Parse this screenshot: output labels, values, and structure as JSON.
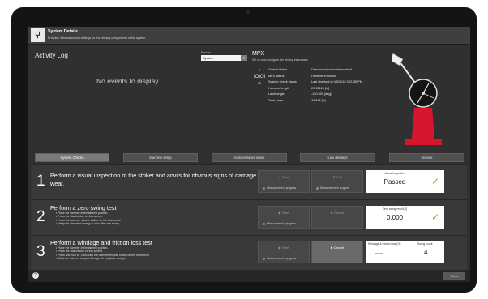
{
  "window": {
    "title": "System Details",
    "subtitle": "Provides information and settings for the primary components of the system.",
    "icon": "fork-knife-icon"
  },
  "activity_log": {
    "title": "Activity Log",
    "empty_text": "No events to display.",
    "device_label": "Source",
    "device_value": "System"
  },
  "mpx": {
    "title": "MPX",
    "subtitle": "Set up and configure the testing instrument.",
    "status_rows": [
      {
        "key": "Overall status",
        "value": "Demonstration mode enabled"
      },
      {
        "key": "MPX status",
        "value": "Hammer in motion"
      },
      {
        "key": "System check status",
        "value": "Last checked at 4/5/2016 3:21:35 PM"
      },
      {
        "key": "Hammer length",
        "value": "29.92126 [in]"
      },
      {
        "key": "Latch angle",
        "value": "-120.000 [deg]"
      },
      {
        "key": "Total mass",
        "value": "44.092 [lb]"
      }
    ],
    "colors": {
      "base": "#d6162e",
      "pendulum": "#111111"
    }
  },
  "tabs": [
    {
      "label": "System Checks",
      "active": true
    },
    {
      "label": "Machine setup",
      "active": false
    },
    {
      "label": "Administrative setup",
      "active": false
    },
    {
      "label": "Live displays",
      "active": false
    },
    {
      "label": "Service",
      "active": false
    }
  ],
  "steps": [
    {
      "number": "1",
      "title": "Perform a visual inspection of the striker and anvils for obvious signs of damage and wear.",
      "bullets": [],
      "btn1": {
        "label": "Pass",
        "progress": "Measurement in progress"
      },
      "btn2": {
        "label": "Fail",
        "progress": "Measurement in progress"
      },
      "result": {
        "caption": "Visual inspection",
        "value": "Passed",
        "check": "✓"
      }
    },
    {
      "number": "2",
      "title": "Perform a zero swing test",
      "bullets": [
        "Place the hammer in the latched position.",
        "Press the Start button on this screen.",
        "Press the hammer release button on the instrument.",
        "Verify the absorbed energy is zero after one swing."
      ],
      "btn1": {
        "label": "Start",
        "progress": "Measurement in progress"
      },
      "btn2": {
        "label": "Cancel"
      },
      "result": {
        "caption": "Zero swing result [J]",
        "value": "0.000",
        "check": "✓"
      }
    },
    {
      "number": "3",
      "title": "Perform a windage and friction loss test",
      "bullets": [
        "Place the hammer in the latched position.",
        "Press the Start button on this screen.",
        "Press and hold for 3 seconds the hammer release button on the instrument.",
        "Allow the hammer to cycle through six complete swings."
      ],
      "btn1": {
        "label": "Start",
        "progress": "Measurement in progress"
      },
      "btn2": {
        "label": "Cancel"
      },
      "result": {
        "caption1": "Windage & friction loss [%]",
        "value1": "------",
        "caption2": "Swing count",
        "value2": "4"
      }
    }
  ],
  "footer": {
    "help": "?",
    "close": "Close"
  }
}
